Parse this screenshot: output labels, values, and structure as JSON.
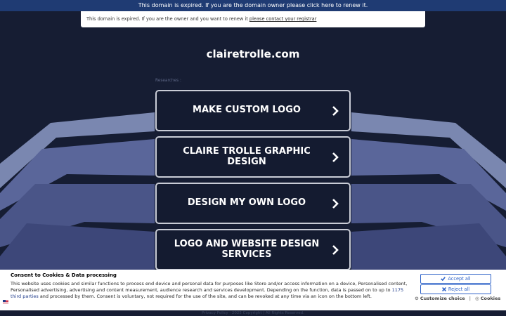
{
  "banner": {
    "text": "This domain is expired. If you are the domain owner please click here to renew it."
  },
  "notice": {
    "text": "This domain is expired. If you are the owner and you want to renew it ",
    "link": "please contact your registrar"
  },
  "domain": "clairetrolle.com",
  "researches_label": "Researches :",
  "links": [
    {
      "label": "MAKE CUSTOM LOGO"
    },
    {
      "label": "CLAIRE TROLLE GRAPHIC DESIGN"
    },
    {
      "label": "DESIGN MY OWN LOGO"
    },
    {
      "label": "LOGO AND WEBSITE DESIGN SERVICES"
    }
  ],
  "cookie": {
    "title": "Consent to Cookies & Data processing",
    "text_before": "This website uses cookies and similar functions to process end device and personal data for purposes like Store and/or access information on a device, Personalised content, Personalised advertising, advertising and content measurement, audience research and services development. Depending on the function, data is passed on to up to ",
    "third_parties_link": "1175 third parties",
    "text_after": " and processed by them. Consent is voluntary, not required for the use of the site, and can be revoked at any time via an icon on the bottom left.",
    "accept_label": "Accept all",
    "reject_label": "Reject all",
    "customize_label": "Customize choice",
    "separator": "|",
    "cookies_label": "Cookies"
  },
  "footer": {
    "privacy": "Privacy Policy",
    "copyright": "2025 Copyright | All Rights Reserved."
  },
  "colors": {
    "background": "#161d33",
    "banner": "#1f3b73",
    "accent_button": "#2f63c8",
    "band_light": "#7f8cb6",
    "band_mid": "#4f5b8a"
  }
}
